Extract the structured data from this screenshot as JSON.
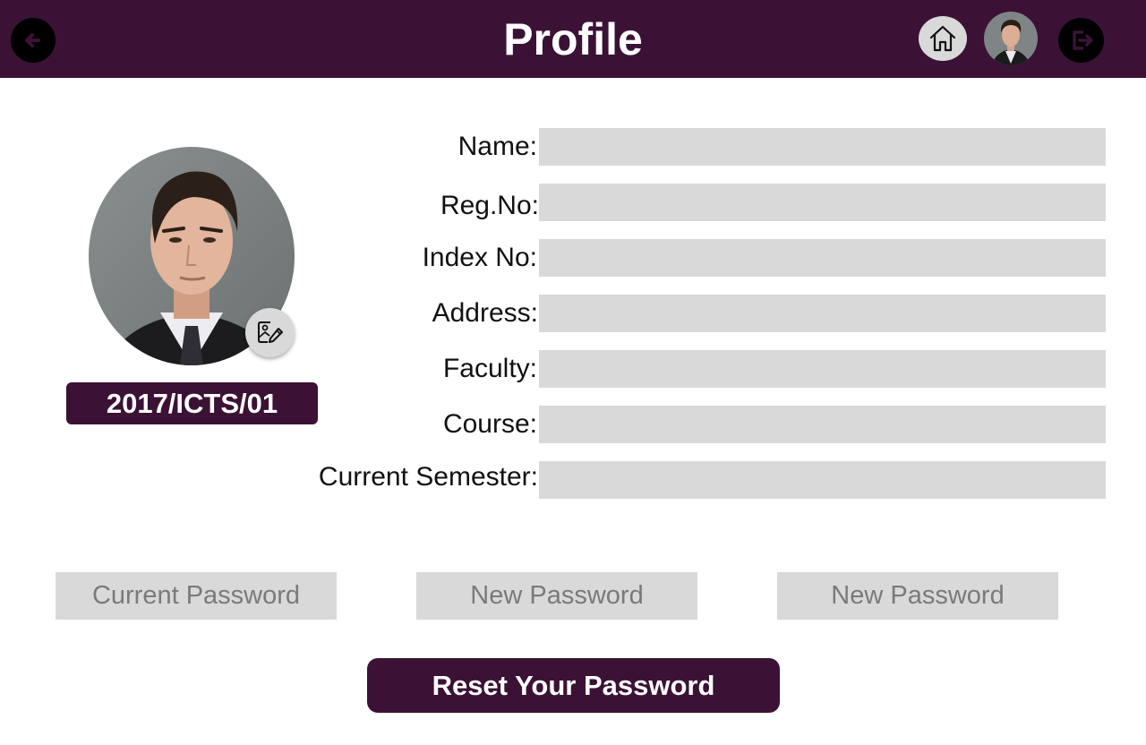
{
  "header": {
    "title": "Profile",
    "back_icon": "arrow-left-icon",
    "home_icon": "home-icon",
    "logout_icon": "logout-icon",
    "brand_color": "#3b1235"
  },
  "profile": {
    "reg_badge": "2017/ICTS/01",
    "edit_photo_icon": "image-edit-icon"
  },
  "fields": [
    {
      "label": "Name:",
      "value": ""
    },
    {
      "label": "Reg.No:",
      "value": ""
    },
    {
      "label": "Index No:",
      "value": ""
    },
    {
      "label": "Address:",
      "value": ""
    },
    {
      "label": "Faculty:",
      "value": ""
    },
    {
      "label": "Course:",
      "value": ""
    },
    {
      "label": "Current Semester:",
      "value": ""
    }
  ],
  "password": {
    "current_placeholder": "Current Password",
    "new_placeholder": "New Password",
    "confirm_placeholder": "New Password",
    "reset_label": "Reset Your Password"
  }
}
